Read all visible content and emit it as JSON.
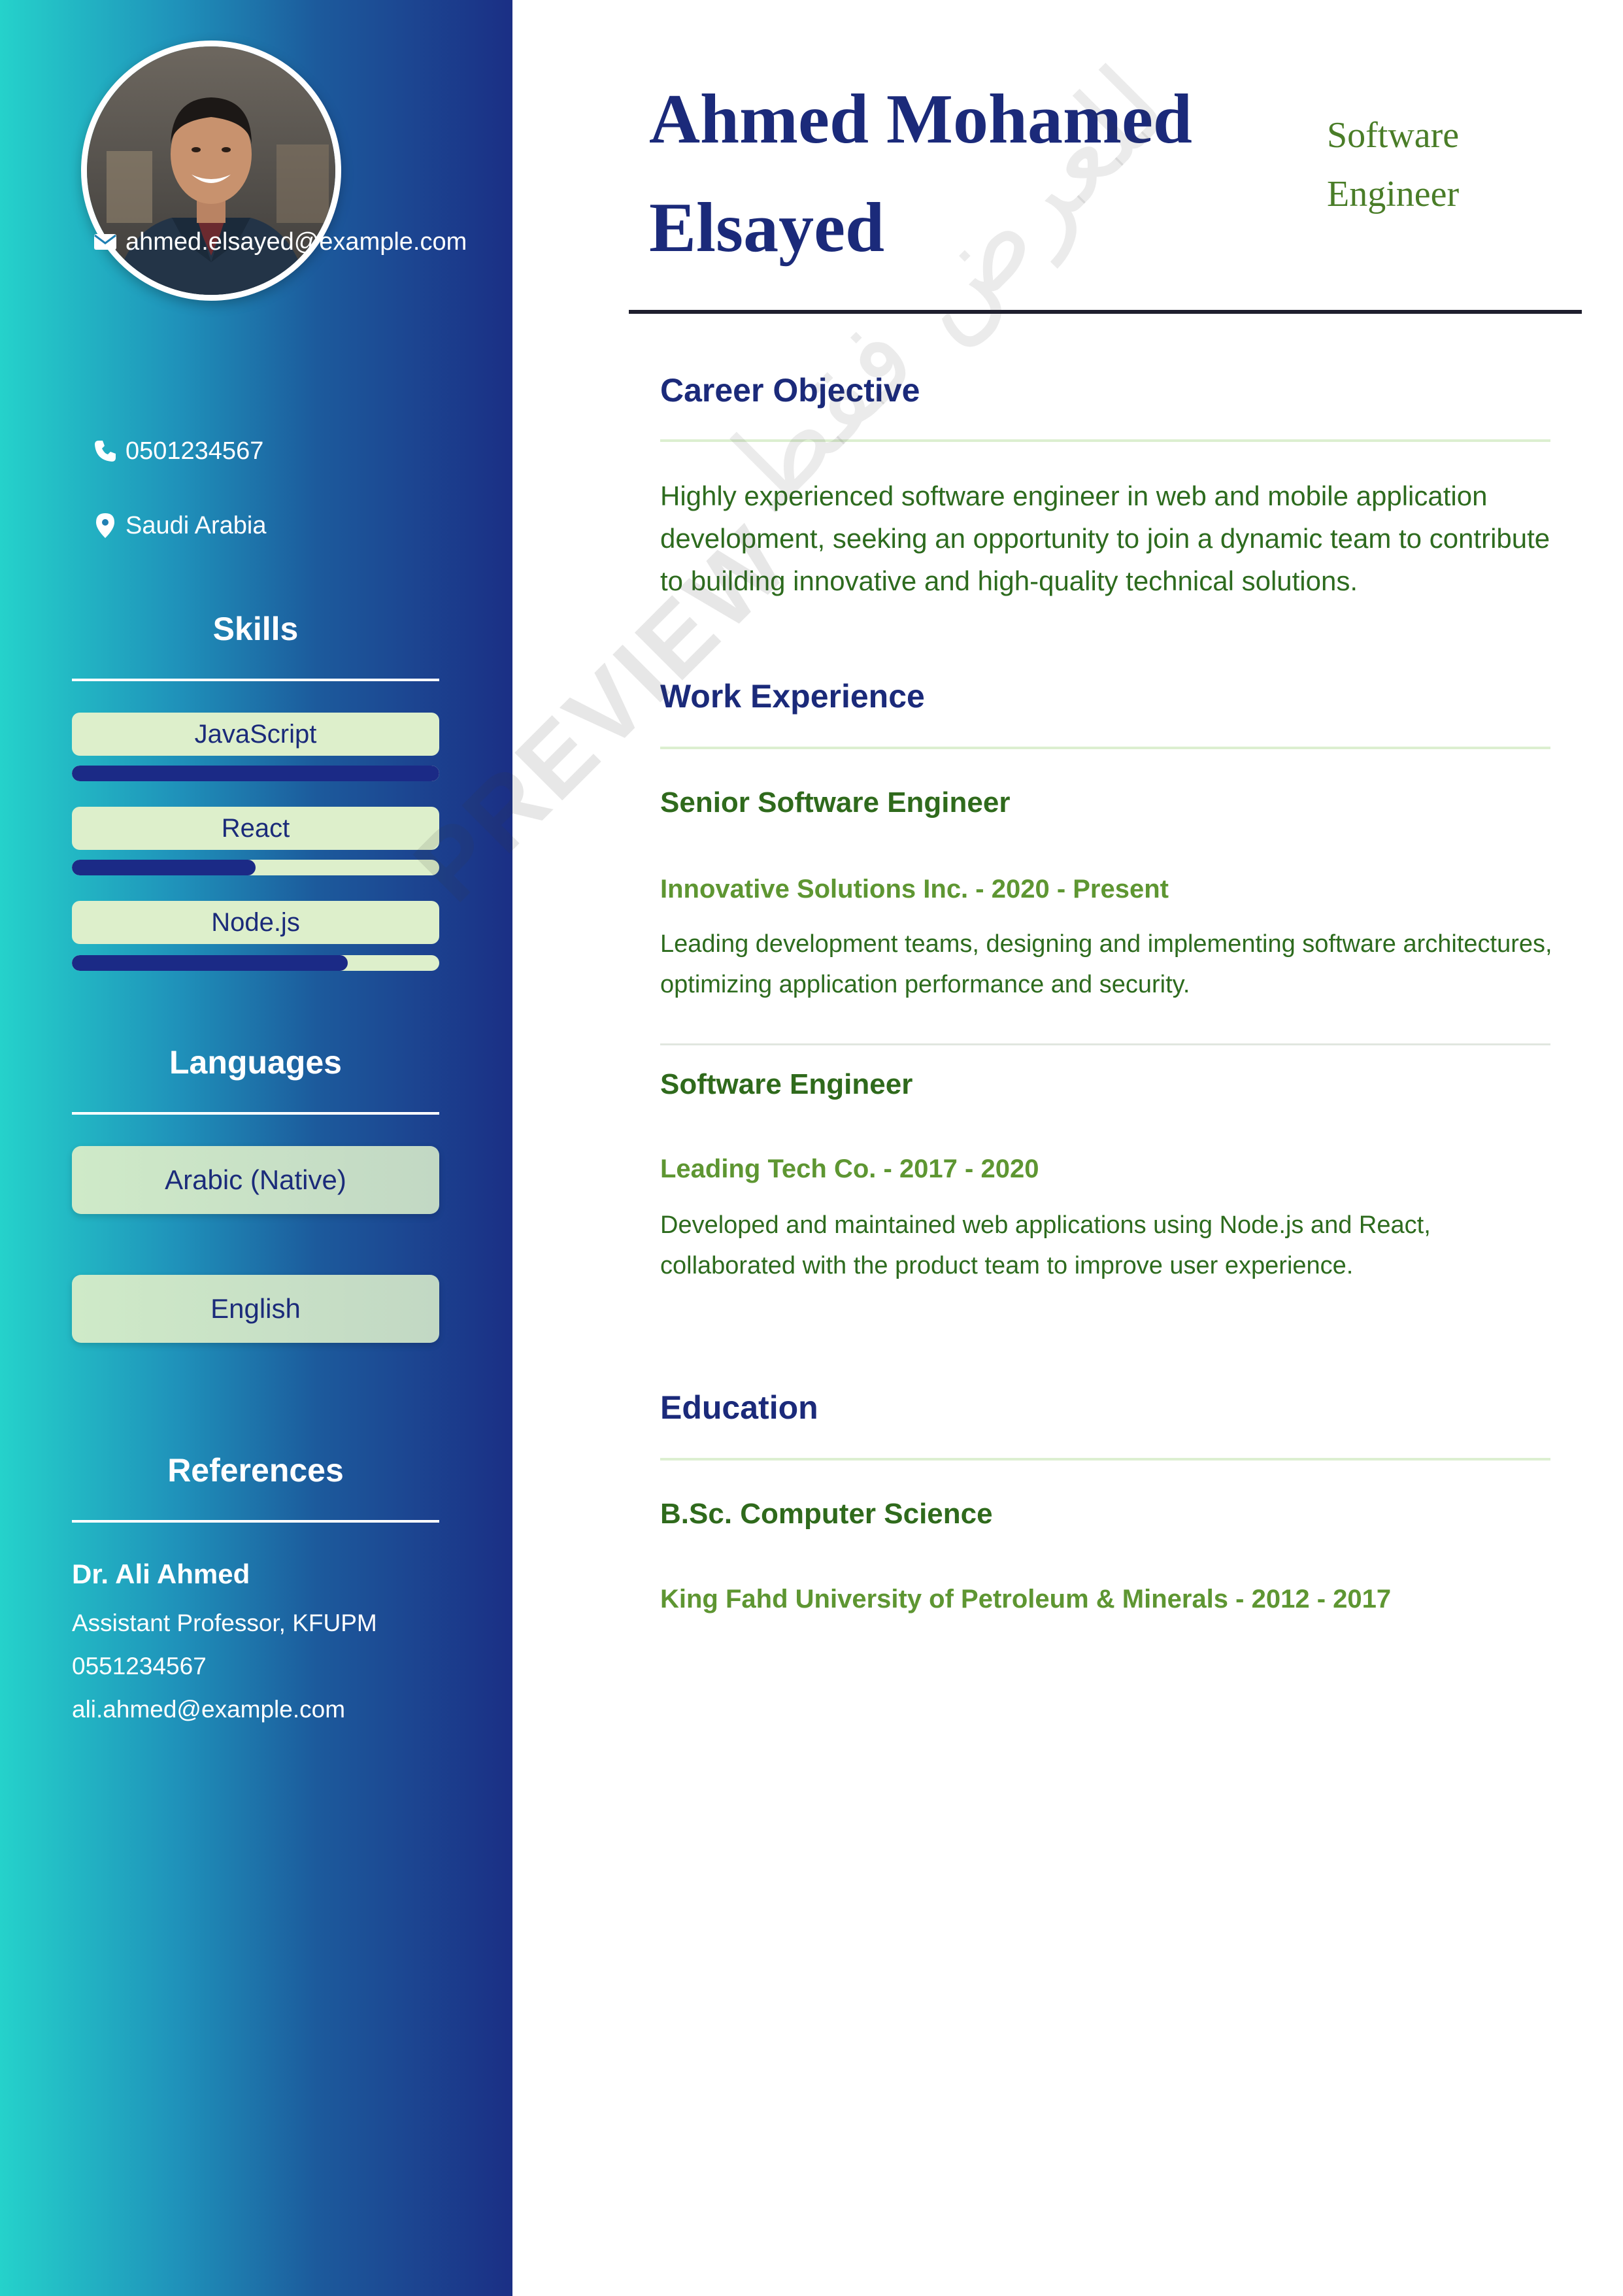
{
  "person": {
    "name": "Ahmed Mohamed Elsayed",
    "title": "Software Engineer"
  },
  "contact": {
    "email": "ahmed.elsayed@example.com",
    "phone": "0501234567",
    "location": "Saudi Arabia",
    "icons": [
      "envelope-icon",
      "phone-icon",
      "location-pin-icon"
    ]
  },
  "skills": {
    "title": "Skills",
    "items": [
      {
        "label": "JavaScript",
        "level": 1.0
      },
      {
        "label": "React",
        "level": 0.5
      },
      {
        "label": "Node.js",
        "level": 0.75
      }
    ]
  },
  "languages": {
    "title": "Languages",
    "items": [
      "Arabic (Native)",
      "English"
    ]
  },
  "references": {
    "title": "References",
    "name": "Dr. Ali Ahmed",
    "position": "Assistant Professor, KFUPM",
    "phone": "0551234567",
    "email": "ali.ahmed@example.com"
  },
  "objective": {
    "title": "Career Objective",
    "text": "Highly experienced software engineer in web and mobile application development, seeking an opportunity to join a dynamic team to contribute to building innovative and high-quality technical solutions."
  },
  "experience": {
    "title": "Work Experience",
    "jobs": [
      {
        "role": "Senior Software Engineer",
        "meta": "Innovative Solutions Inc. - 2020 - Present",
        "description": "Leading development teams, designing and implementing software architectures, optimizing application performance and security."
      },
      {
        "role": "Software Engineer",
        "meta": "Leading Tech Co. - 2017 - 2020",
        "description": "Developed and maintained web applications using Node.js and React, collaborated with the product team to improve user experience."
      }
    ]
  },
  "education": {
    "title": "Education",
    "degree": "B.Sc. Computer Science",
    "meta": "King Fahd University of Petroleum & Minerals - 2012 - 2017"
  },
  "watermark": {
    "latin": "PREVIEW",
    "arabic": "للعرض فقط"
  },
  "colors": {
    "primary": "#1b2a7a",
    "accent_green": "#2f6a1c",
    "sidebar_start": "#25d2cb",
    "sidebar_end": "#1b2f85",
    "pill": "#ddefcb"
  }
}
